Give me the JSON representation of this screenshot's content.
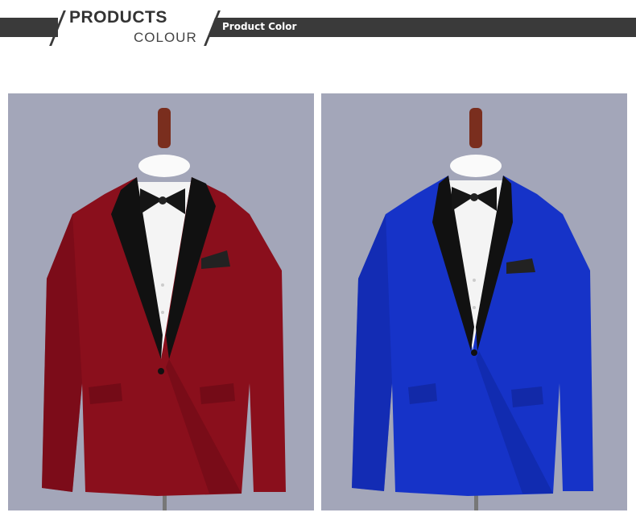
{
  "header": {
    "title": "PRODUCTS",
    "subtitle": "COLOUR",
    "bar_label": "Product Color"
  },
  "photos": [
    {
      "color_name": "burgundy",
      "jacket_color": "#8a0f1c",
      "background": "#a3a6b9"
    },
    {
      "color_name": "royal blue",
      "jacket_color": "#1633c8",
      "background": "#a3a6b9"
    }
  ],
  "colors": {
    "bar": "#3a3a3a",
    "lapel": "#111111",
    "shirt": "#f2f2f2",
    "stand": "#7a2e1e"
  }
}
